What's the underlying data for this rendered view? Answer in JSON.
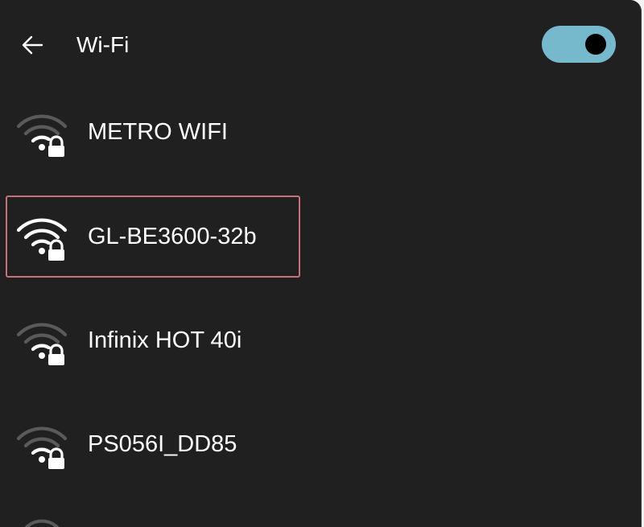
{
  "header": {
    "back_icon": "arrow-left-icon",
    "title": "Wi-Fi",
    "toggle_state": "on",
    "toggle_color": "#76b9cc"
  },
  "networks": [
    {
      "label": "METRO WIFI",
      "signal_bars": 2,
      "secured": true,
      "selected": false
    },
    {
      "label": "GL-BE3600-32b",
      "signal_bars": 4,
      "secured": true,
      "selected": true
    },
    {
      "label": "Infinix HOT 40i",
      "signal_bars": 2,
      "secured": true,
      "selected": false
    },
    {
      "label": "PS056I_DD85",
      "signal_bars": 2,
      "secured": true,
      "selected": false
    }
  ],
  "colors": {
    "background": "#202020",
    "text": "#ffffff",
    "selection_border": "#c8707a",
    "signal_active": "#ffffff",
    "signal_inactive": "#5a5a5a"
  }
}
